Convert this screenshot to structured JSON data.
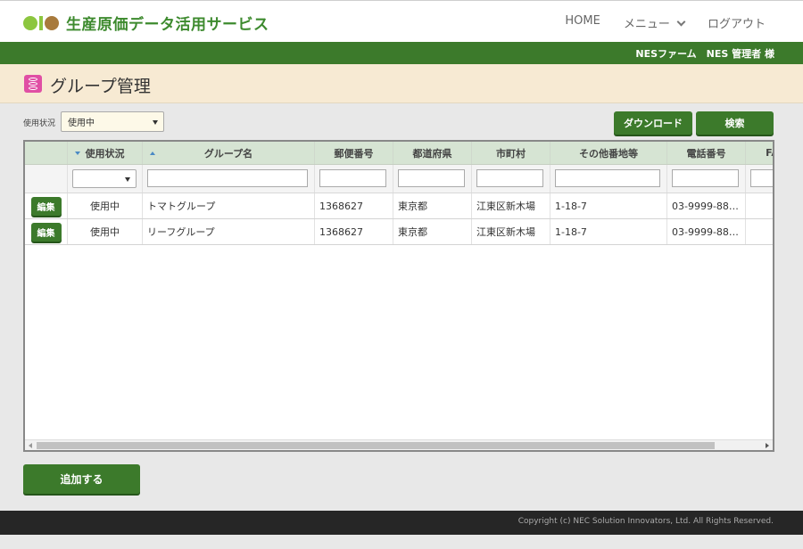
{
  "app": {
    "title": "生産原価データ活用サービス"
  },
  "nav": {
    "home": "HOME",
    "menu": "メニュー",
    "logout": "ログアウト"
  },
  "user": {
    "name": "NESファーム　NES 管理者 様"
  },
  "page": {
    "title": "グループ管理"
  },
  "filter": {
    "label": "使用状況",
    "status_value": "使用中"
  },
  "toolbar": {
    "download_label": "ダウンロード",
    "search_label": "検索",
    "add_label": "追加する"
  },
  "table": {
    "columns": [
      "使用状況",
      "グループ名",
      "郵便番号",
      "都道府県",
      "市町村",
      "その他番地等",
      "電話番号",
      "FA"
    ],
    "edit_label": "編集",
    "rows": [
      {
        "status": "使用中",
        "group": "トマトグループ",
        "zip": "1368627",
        "pref": "東京都",
        "city": "江東区新木場",
        "addr": "1-18-7",
        "tel": "03-9999-88…"
      },
      {
        "status": "使用中",
        "group": "リーフグループ",
        "zip": "1368627",
        "pref": "東京都",
        "city": "江東区新木場",
        "addr": "1-18-7",
        "tel": "03-9999-88…"
      }
    ]
  },
  "footer": {
    "copyright": "Copyright (c) NEC Solution Innovators, Ltd. All Rights Reserved."
  },
  "colors": {
    "brand_green": "#3c7a2b",
    "title_bg": "#f7ead3",
    "accent_pink": "#e04fa4"
  }
}
